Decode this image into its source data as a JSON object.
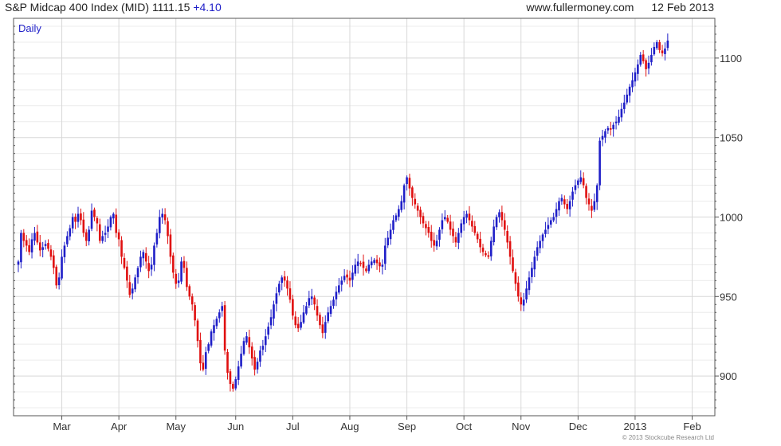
{
  "header": {
    "title": "S&P Midcap 400 Index (MID)",
    "price": "1111.15",
    "change": "+4.10",
    "website": "www.fullermoney.com",
    "date": "12 Feb 2013"
  },
  "copyright": "© 2013 Stockcube Research Ltd",
  "colors": {
    "up": "#1f1fc8",
    "down": "#e01010",
    "grid": "#d8d8d8",
    "frame": "#555555",
    "label_blue": "#1f1fc8"
  },
  "chart_data": {
    "type": "candlestick",
    "title": "S&P Midcap 400 Index (MID)",
    "period_label": "Daily",
    "ylim": [
      875,
      1125
    ],
    "y_ticks": [
      900,
      950,
      1000,
      1050,
      1100
    ],
    "grid": true,
    "x_month_labels": [
      "Mar",
      "Apr",
      "May",
      "Jun",
      "Jul",
      "Aug",
      "Sep",
      "Oct",
      "Nov",
      "Dec",
      "2013",
      "Feb"
    ],
    "x_month_positions": [
      16,
      37,
      58,
      80,
      101,
      122,
      143,
      164,
      185,
      206,
      227,
      248
    ],
    "x_count": 255,
    "closes": [
      972,
      990,
      985,
      982,
      978,
      986,
      990,
      984,
      979,
      981,
      983,
      980,
      975,
      968,
      957,
      962,
      975,
      982,
      988,
      993,
      1000,
      997,
      1002,
      998,
      990,
      985,
      992,
      1004,
      1000,
      996,
      985,
      988,
      990,
      994,
      1000,
      1002,
      990,
      986,
      975,
      968,
      960,
      951,
      955,
      962,
      968,
      975,
      978,
      972,
      966,
      970,
      982,
      990,
      1000,
      1002,
      998,
      988,
      975,
      965,
      958,
      960,
      972,
      968,
      956,
      950,
      945,
      935,
      922,
      908,
      904,
      915,
      920,
      928,
      932,
      936,
      940,
      944,
      916,
      902,
      895,
      892,
      898,
      906,
      914,
      922,
      925,
      918,
      911,
      904,
      909,
      916,
      919,
      925,
      931,
      937,
      945,
      952,
      958,
      962,
      960,
      955,
      948,
      938,
      932,
      930,
      934,
      940,
      944,
      949,
      950,
      945,
      938,
      932,
      927,
      934,
      940,
      944,
      948,
      953,
      957,
      960,
      963,
      962,
      960,
      965,
      970,
      972,
      971,
      968,
      966,
      970,
      972,
      973,
      971,
      969,
      970,
      982,
      987,
      992,
      998,
      1001,
      1005,
      1010,
      1020,
      1025,
      1018,
      1012,
      1008,
      1004,
      1000,
      996,
      993,
      990,
      985,
      982,
      985,
      992,
      998,
      1000,
      997,
      992,
      988,
      984,
      990,
      996,
      1000,
      1002,
      998,
      994,
      990,
      986,
      981,
      978,
      976,
      975,
      985,
      994,
      1000,
      1003,
      998,
      992,
      984,
      975,
      966,
      958,
      950,
      945,
      948,
      955,
      962,
      968,
      975,
      981,
      985,
      989,
      992,
      995,
      998,
      1000,
      1005,
      1010,
      1012,
      1008,
      1005,
      1010,
      1016,
      1020,
      1023,
      1025,
      1020,
      1012,
      1008,
      1004,
      1010,
      1020,
      1048,
      1051,
      1054,
      1056,
      1055,
      1058,
      1060,
      1063,
      1068,
      1072,
      1077,
      1082,
      1086,
      1091,
      1096,
      1102,
      1098,
      1093,
      1097,
      1102,
      1107,
      1110,
      1105,
      1103,
      1106,
      1111
    ]
  }
}
